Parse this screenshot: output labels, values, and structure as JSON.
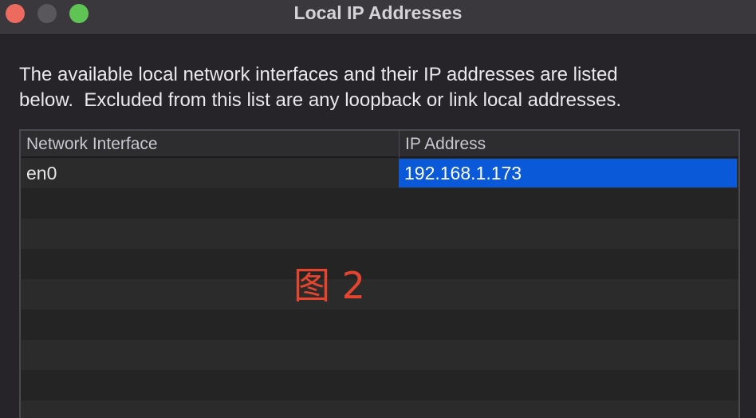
{
  "window": {
    "title": "Local IP Addresses"
  },
  "description": "The available local network interfaces and their IP addresses are listed\nbelow.  Excluded from this list are any loopback or link local addresses.",
  "table": {
    "columns": [
      "Network Interface",
      "IP Address"
    ],
    "rows": [
      {
        "interface": "en0",
        "ip": "192.168.1.173",
        "selected_column": "ip"
      }
    ],
    "empty_rows": 8
  },
  "overlay_label": "图 2",
  "colors": {
    "selection": "#0a59d8",
    "overlay_text": "#e3452f",
    "close_button": "#ec6a5e",
    "minimize_button": "#59575c",
    "zoom_button": "#5fc454"
  }
}
